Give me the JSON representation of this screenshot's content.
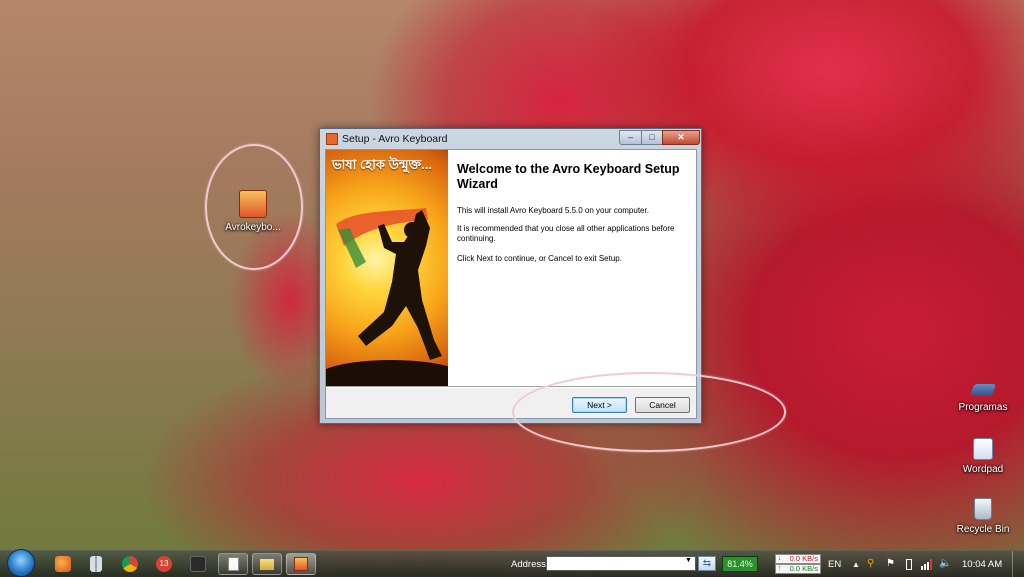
{
  "desktop": {
    "icons": [
      {
        "name": "avro-shortcut",
        "label": "Avrokeybo..."
      },
      {
        "name": "programas",
        "label": "Programas"
      },
      {
        "name": "wordpad",
        "label": "Wordpad"
      },
      {
        "name": "recycle-bin",
        "label": "Recycle Bin"
      }
    ]
  },
  "dialog": {
    "title": "Setup - Avro Keyboard",
    "banner_slogan": "ভাষা হোক উন্মুক্ত...",
    "heading": "Welcome to the Avro Keyboard Setup Wizard",
    "paragraphs": [
      "This will install Avro Keyboard 5.5.0 on your computer.",
      "It is recommended that you close all other applications before continuing.",
      "Click Next to continue, or Cancel to exit Setup."
    ],
    "next_label": "Next >",
    "cancel_label": "Cancel",
    "window_buttons": {
      "minimize": "–",
      "maximize": "□",
      "close": "✕"
    }
  },
  "taskbar": {
    "address_label": "Address",
    "address_value": "",
    "go_symbol": "⇆",
    "cpu": "81.4%",
    "net_down": "0.0 KB/s",
    "net_up": "0.0 KB/s",
    "language": "EN",
    "clock": "10:04 AM",
    "pinned_badge": "13"
  },
  "colors": {
    "next_button": "#bee6fd",
    "cpu_meter": "#2f8f2f",
    "annotation_ring": "#f3c9cf"
  }
}
